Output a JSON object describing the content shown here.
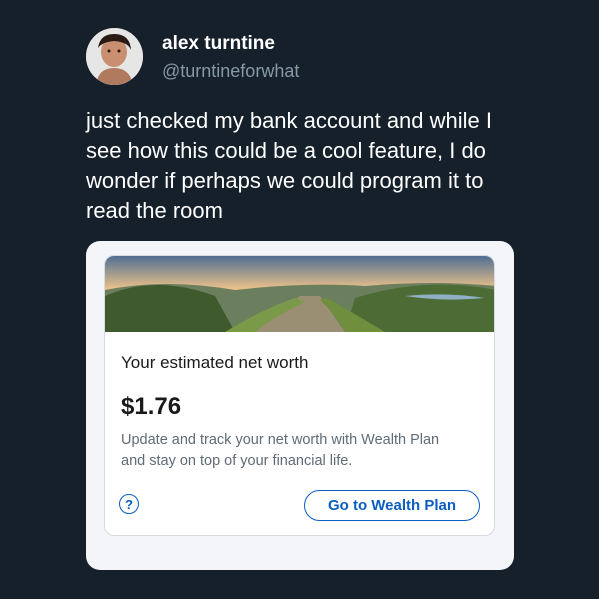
{
  "tweet": {
    "display_name": "alex turntine",
    "handle": "@turntineforwhat",
    "text": "just checked my bank account and while I see how this could be a cool feature, I do wonder if perhaps we could program it to read the room"
  },
  "card": {
    "heading": "Your estimated net worth",
    "amount": "$1.76",
    "description": "Update and track your net worth with Wealth Plan and stay on top of your financial life.",
    "help_icon_glyph": "?",
    "button_label": "Go to Wealth Plan",
    "accent_color": "#0a5ec2"
  },
  "icons": {
    "help": "question-circle-icon"
  }
}
